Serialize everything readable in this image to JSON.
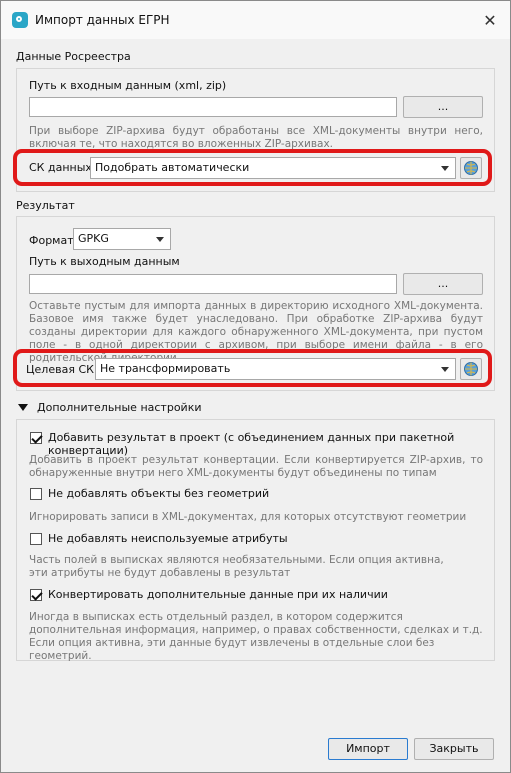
{
  "window": {
    "title": "Импорт данных ЕГРН",
    "close_glyph": "✕"
  },
  "source": {
    "section_title": "Данные Росреестра",
    "input_label": "Путь к входным данным (xml, zip)",
    "input_value": "",
    "browse_label": "...",
    "hint": "При выборе ZIP-архива будут обработаны все XML-документы внутри него, включая те, что находятся во вложенных ZIP-архивах.",
    "crs_label": "СК данных",
    "crs_value": "Подобрать автоматически"
  },
  "result": {
    "section_title": "Результат",
    "format_label": "Формат",
    "format_value": "GPKG",
    "output_label": "Путь к выходным данным",
    "output_value": "",
    "browse_label": "...",
    "hint": "Оставьте пустым для импорта данных в директорию исходного XML-документа. Базовое имя также будет унаследовано. При обработке ZIP-архива будут созданы директории для каждого обнаруженного XML-документа, при пустом поле - в одной директории с архивом, при выборе имени файла - в его родительской директории",
    "crs_label": "Целевая СК",
    "crs_value": "Не трансформировать"
  },
  "advanced": {
    "title": "Дополнительные настройки",
    "options": [
      {
        "label": "Добавить результат в проект (с объединением данных при пакетной конвертации)",
        "checked": true,
        "hint": "Добавить в проект результат конвертации. Если конвертируется ZIP-архив, то обнаруженные внутри него XML-документы будут объединены по типам"
      },
      {
        "label": "Не добавлять объекты без геометрий",
        "checked": false,
        "hint": "Игнорировать записи в XML-документах, для которых отсутствуют геометрии"
      },
      {
        "label": "Не добавлять неиспользуемые атрибуты",
        "checked": false,
        "hint": "Часть полей в выписках являются необязательными. Если опция активна, эти атрибуты не будут добавлены в результат"
      },
      {
        "label": "Конвертировать дополнительные данные при их наличии",
        "checked": true,
        "hint": "Иногда в выписках есть отдельный раздел, в котором содержится дополнительная информация, например, о правах собственности, сделках и т.д. Если опция активна, эти данные будут извлечены в отдельные слои без геометрий."
      }
    ]
  },
  "footer": {
    "import_label": "Импорт",
    "close_label": "Закрыть"
  },
  "colors": {
    "highlight": "#e01919",
    "accent": "#2aa6c7"
  }
}
